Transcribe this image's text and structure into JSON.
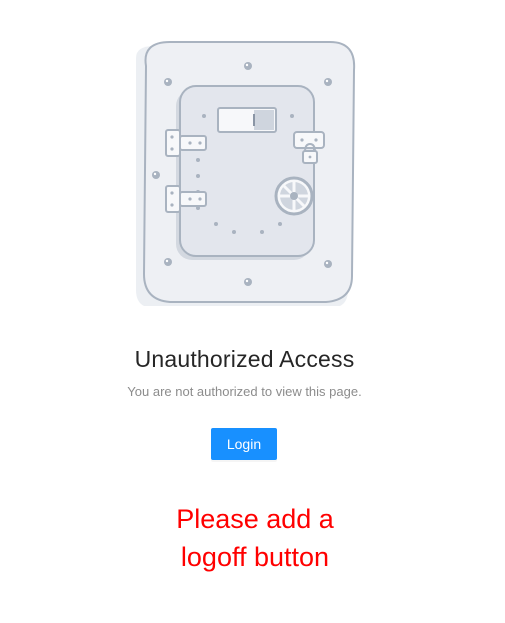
{
  "result": {
    "title": "Unauthorized Access",
    "subtitle": "You are not authorized to view this page.",
    "login_button_label": "Login"
  },
  "annotation": {
    "line1": "Please add a",
    "line2": "logoff button",
    "color": "#ff0000"
  },
  "colors": {
    "primary": "#1890ff",
    "illustration_stroke": "#a9b3c0",
    "illustration_fill": "#eef0f4"
  },
  "icons": {
    "illustration": "vault-door-illustration"
  }
}
